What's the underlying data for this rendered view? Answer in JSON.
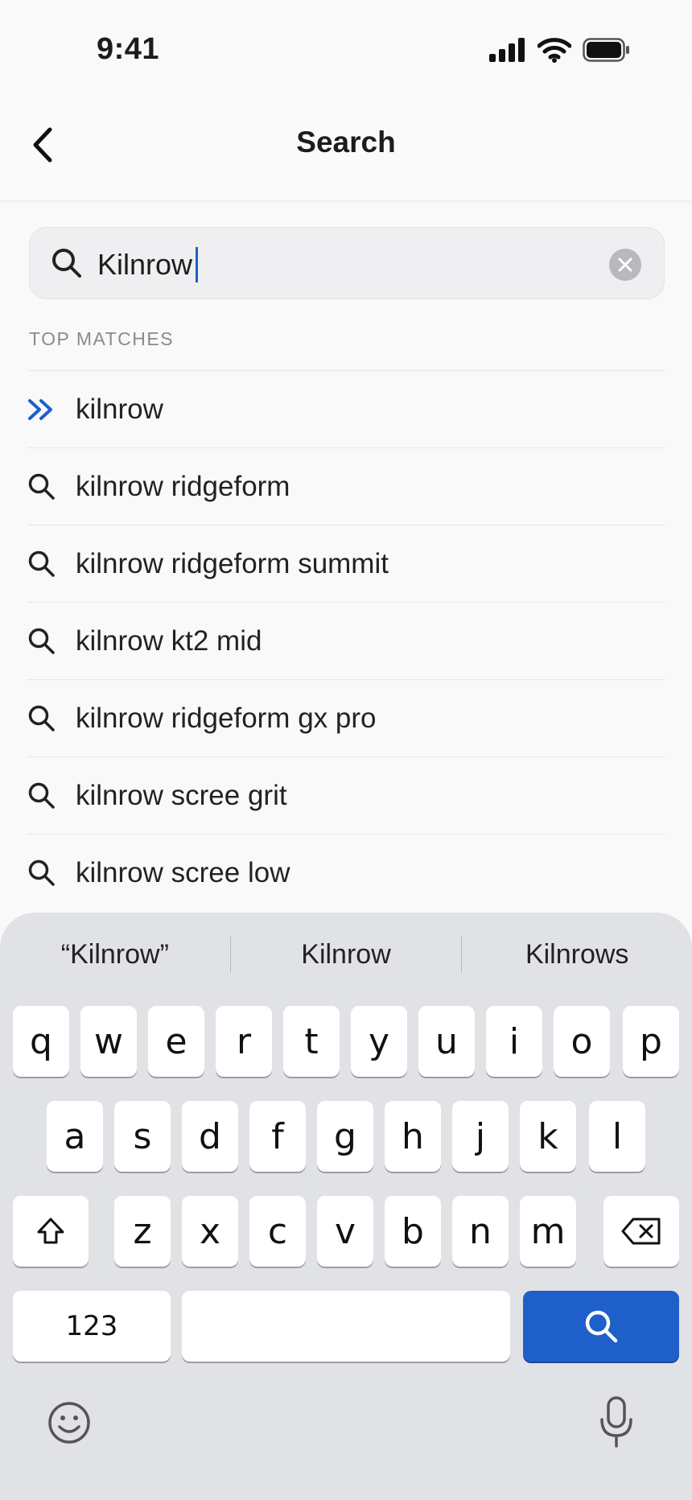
{
  "status": {
    "time": "9:41"
  },
  "nav": {
    "title": "Search"
  },
  "search": {
    "value": "Kilnrow"
  },
  "section": {
    "label": "TOP MATCHES"
  },
  "results": [
    {
      "text": "kilnrow",
      "icon": "double-chevron-right-icon"
    },
    {
      "text": "kilnrow ridgeform",
      "icon": "search-icon"
    },
    {
      "text": "kilnrow ridgeform summit",
      "icon": "search-icon"
    },
    {
      "text": "kilnrow kt2 mid",
      "icon": "search-icon"
    },
    {
      "text": "kilnrow ridgeform gx pro",
      "icon": "search-icon"
    },
    {
      "text": "kilnrow scree grit",
      "icon": "search-icon"
    },
    {
      "text": "kilnrow scree low",
      "icon": "search-icon"
    }
  ],
  "keyboard": {
    "suggestions": [
      "“Kilnrow”",
      "Kilnrow",
      "Kilnrows"
    ],
    "row1": [
      "q",
      "w",
      "e",
      "r",
      "t",
      "y",
      "u",
      "i",
      "o",
      "p"
    ],
    "row2": [
      "a",
      "s",
      "d",
      "f",
      "g",
      "h",
      "j",
      "k",
      "l"
    ],
    "row3": [
      "z",
      "x",
      "c",
      "v",
      "b",
      "n",
      "m"
    ],
    "numbers_label": "123"
  },
  "colors": {
    "accent": "#1f5fc9",
    "keyboard_bg": "#e1e2e6"
  }
}
